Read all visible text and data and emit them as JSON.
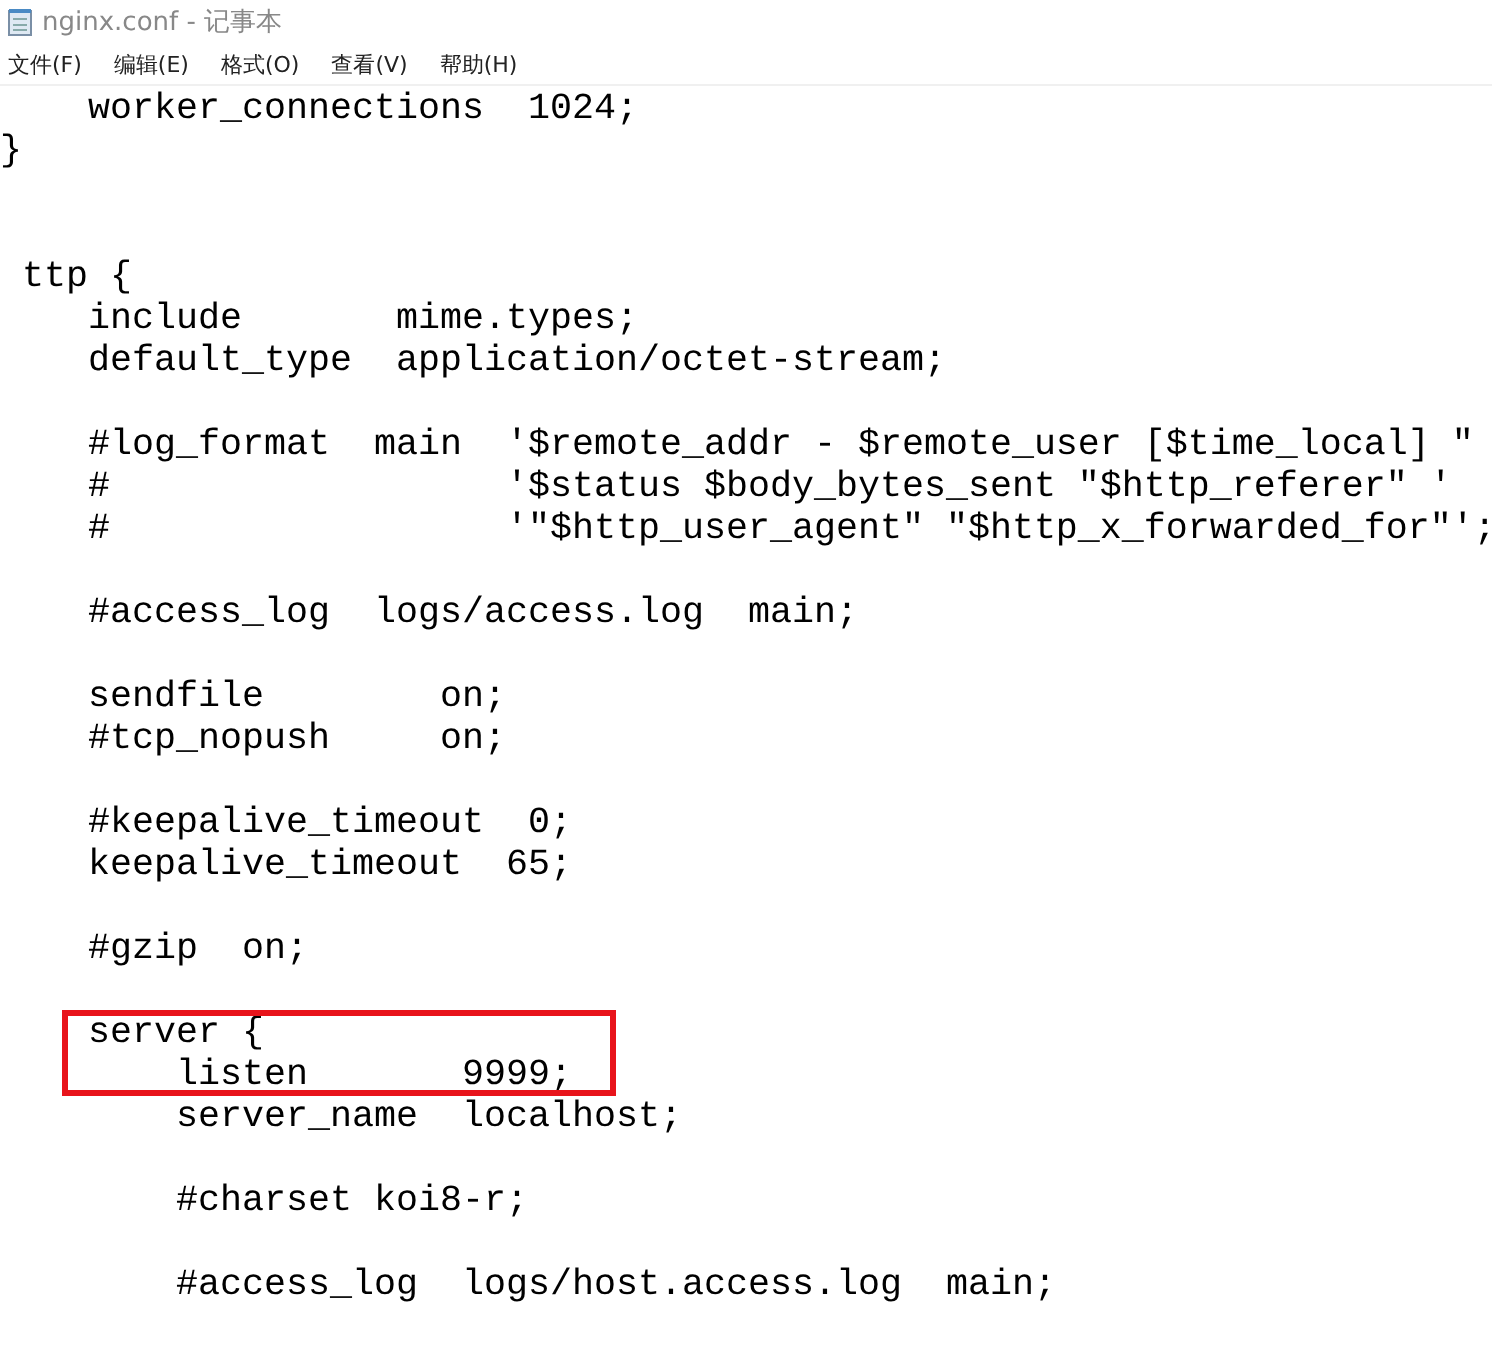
{
  "window": {
    "title": "nginx.conf - 记事本"
  },
  "menu": [
    {
      "label": "文件(F)"
    },
    {
      "label": "编辑(E)"
    },
    {
      "label": "格式(O)"
    },
    {
      "label": "查看(V)"
    },
    {
      "label": "帮助(H)"
    }
  ],
  "lines": [
    {
      "kind": "code",
      "text": "    worker_connections  1024;",
      "highlighted": false
    },
    {
      "kind": "code",
      "text": "}",
      "highlighted": false
    },
    {
      "kind": "blank",
      "highlighted": false
    },
    {
      "kind": "blank",
      "highlighted": false
    },
    {
      "kind": "code",
      "text": " ttp {",
      "highlighted": false
    },
    {
      "kind": "code",
      "text": "    include       mime.types;",
      "highlighted": false
    },
    {
      "kind": "code",
      "text": "    default_type  application/octet-stream;",
      "highlighted": false
    },
    {
      "kind": "blank",
      "highlighted": false
    },
    {
      "kind": "code",
      "text": "    #log_format  main  '$remote_addr - $remote_user [$time_local] \"",
      "highlighted": false
    },
    {
      "kind": "code",
      "text": "    #                  '$status $body_bytes_sent \"$http_referer\" '",
      "highlighted": false
    },
    {
      "kind": "code",
      "text": "    #                  '\"$http_user_agent\" \"$http_x_forwarded_for\"';",
      "highlighted": false
    },
    {
      "kind": "blank",
      "highlighted": false
    },
    {
      "kind": "code",
      "text": "    #access_log  logs/access.log  main;",
      "highlighted": false
    },
    {
      "kind": "blank",
      "highlighted": false
    },
    {
      "kind": "code",
      "text": "    sendfile        on;",
      "highlighted": false
    },
    {
      "kind": "code",
      "text": "    #tcp_nopush     on;",
      "highlighted": false
    },
    {
      "kind": "blank",
      "highlighted": false
    },
    {
      "kind": "code",
      "text": "    #keepalive_timeout  0;",
      "highlighted": false
    },
    {
      "kind": "code",
      "text": "    keepalive_timeout  65;",
      "highlighted": false
    },
    {
      "kind": "blank",
      "highlighted": false
    },
    {
      "kind": "code",
      "text": "    #gzip  on;",
      "highlighted": false
    },
    {
      "kind": "blank",
      "highlighted": false
    },
    {
      "kind": "code",
      "text": "    server {",
      "highlighted": true
    },
    {
      "kind": "code",
      "text": "        listen       9999;",
      "highlighted": true
    },
    {
      "kind": "code",
      "text": "        server_name  localhost;",
      "highlighted": false
    },
    {
      "kind": "blank",
      "highlighted": false
    },
    {
      "kind": "code",
      "text": "        #charset koi8-r;",
      "highlighted": false
    },
    {
      "kind": "blank",
      "highlighted": false
    },
    {
      "kind": "code",
      "text": "        #access_log  logs/host.access.log  main;",
      "highlighted": false
    }
  ]
}
